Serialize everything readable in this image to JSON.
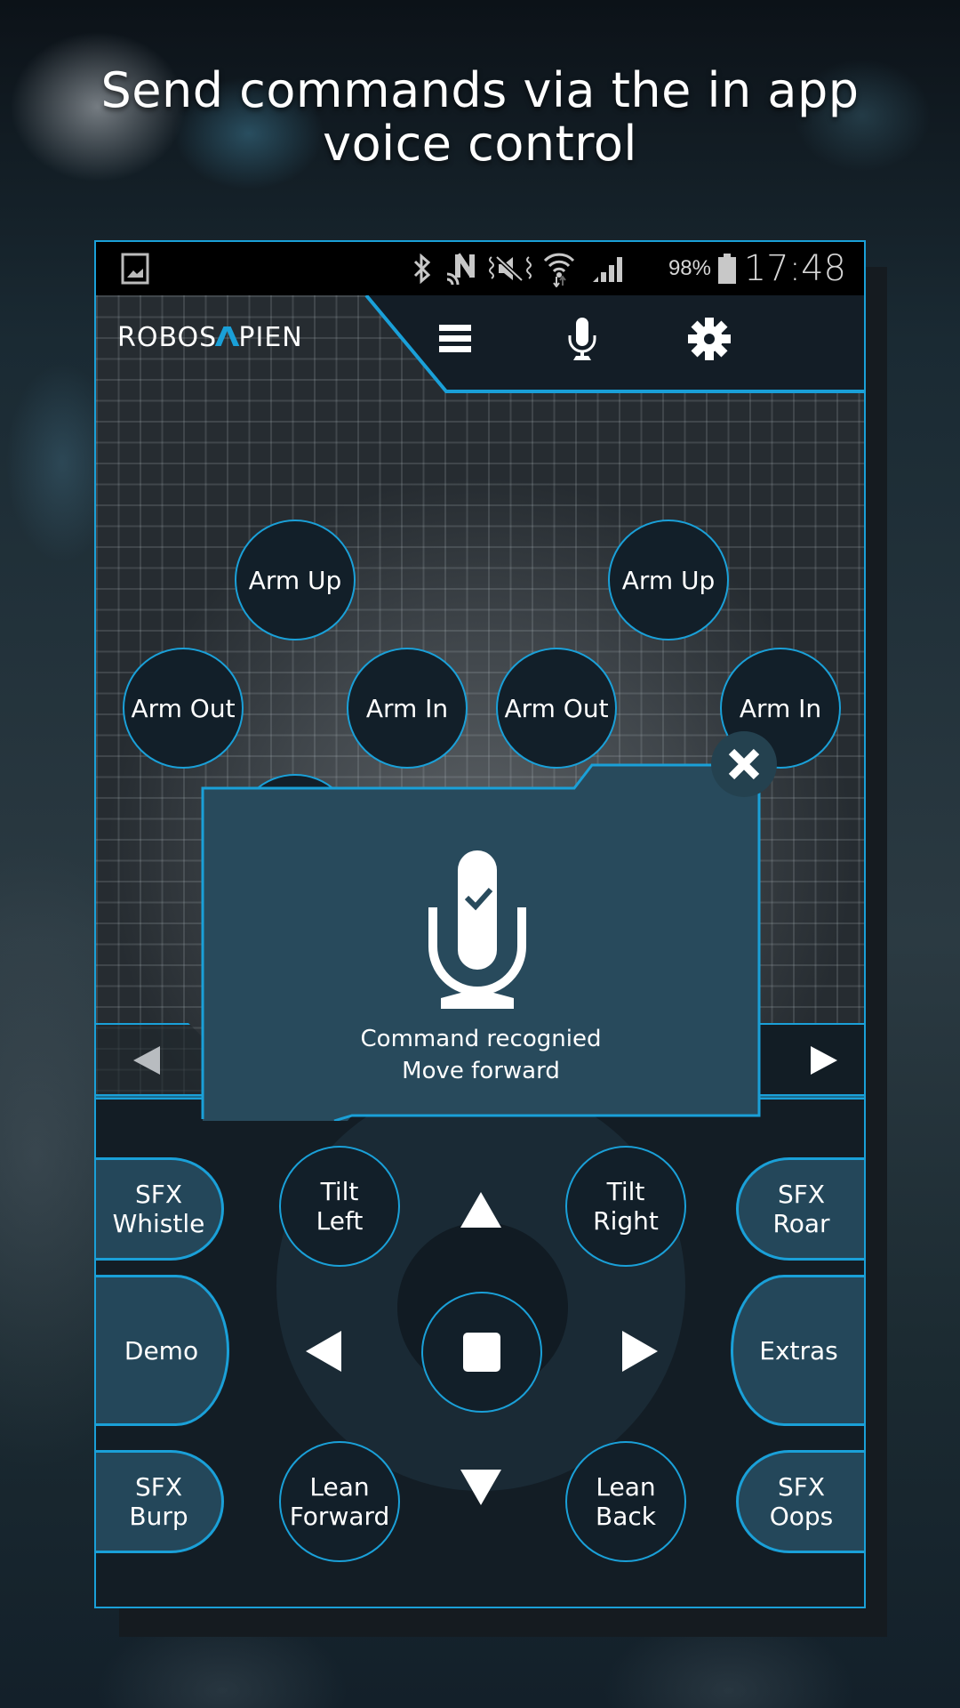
{
  "headline": {
    "line1": "Send commands via the in app",
    "line2": "voice control"
  },
  "status_bar": {
    "icons": [
      "gallery-icon",
      "bluetooth-icon",
      "nfc-icon",
      "mute-vibrate-icon",
      "wifi-icon",
      "signal-icon",
      "battery-icon"
    ],
    "battery_percent": "98%",
    "time": "17:48"
  },
  "header": {
    "logo_part1": "ROBOS",
    "logo_chevron": "Λ",
    "logo_part2": "PIEN",
    "buttons": [
      "menu-icon",
      "microphone-icon",
      "gear-icon"
    ]
  },
  "arm_buttons": [
    {
      "label": "Arm Up"
    },
    {
      "label": "Arm Up"
    },
    {
      "label": "Arm Out"
    },
    {
      "label": "Arm In"
    },
    {
      "label": "Arm Out"
    },
    {
      "label": "Arm In"
    }
  ],
  "voice_popup": {
    "icon": "microphone-check-icon",
    "line1": "Command recognied",
    "line2": "Move forward",
    "close_icon": "close-icon"
  },
  "nav": {
    "prev_icon": "triangle-left-icon",
    "next_icon": "triangle-right-icon"
  },
  "controls": {
    "side_tabs": {
      "sfx_whistle": [
        "SFX",
        "Whistle"
      ],
      "demo": "Demo",
      "sfx_burp": [
        "SFX",
        "Burp"
      ],
      "sfx_roar": [
        "SFX",
        "Roar"
      ],
      "extras": "Extras",
      "sfx_oops": [
        "SFX",
        "Oops"
      ]
    },
    "round": {
      "tilt_left": [
        "Tilt",
        "Left"
      ],
      "tilt_right": [
        "Tilt",
        "Right"
      ],
      "lean_forward": [
        "Lean",
        "Forward"
      ],
      "lean_back": [
        "Lean",
        "Back"
      ]
    },
    "dpad": [
      "up",
      "down",
      "left",
      "right",
      "stop"
    ]
  },
  "colors": {
    "accent": "#1aa0d8",
    "button_bg": "#121f29",
    "popup_bg": "#284a5c",
    "side_tab_bg": "#24475a"
  }
}
